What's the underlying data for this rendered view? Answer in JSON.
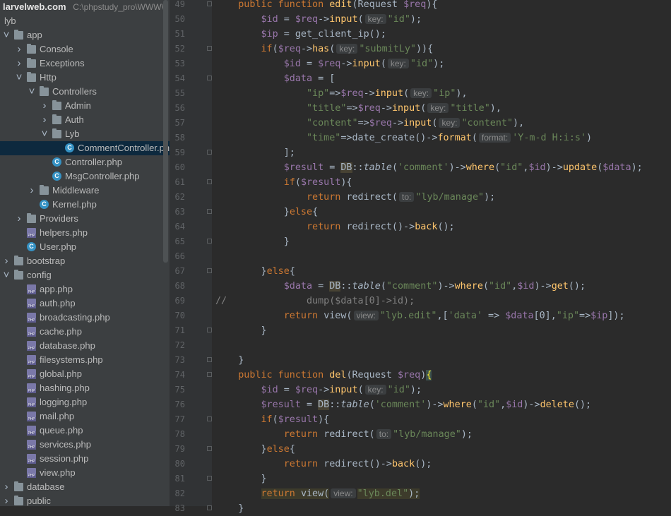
{
  "project": {
    "name": "larvelweb.com",
    "path": "C:\\phpstudy_pro\\WWW\\"
  },
  "tree": [
    {
      "label": "lyb",
      "depth": 0,
      "type": "root",
      "arrow": ""
    },
    {
      "label": "app",
      "depth": 0,
      "type": "folder",
      "arrow": "v"
    },
    {
      "label": "Console",
      "depth": 1,
      "type": "folder",
      "arrow": ">"
    },
    {
      "label": "Exceptions",
      "depth": 1,
      "type": "folder",
      "arrow": ">"
    },
    {
      "label": "Http",
      "depth": 1,
      "type": "folder",
      "arrow": "v"
    },
    {
      "label": "Controllers",
      "depth": 2,
      "type": "folder",
      "arrow": "v"
    },
    {
      "label": "Admin",
      "depth": 3,
      "type": "folder",
      "arrow": ">"
    },
    {
      "label": "Auth",
      "depth": 3,
      "type": "folder",
      "arrow": ">"
    },
    {
      "label": "Lyb",
      "depth": 3,
      "type": "folder",
      "arrow": "v"
    },
    {
      "label": "CommentController.php",
      "depth": 4,
      "type": "class",
      "arrow": "",
      "selected": true
    },
    {
      "label": "Controller.php",
      "depth": 3,
      "type": "class",
      "arrow": ""
    },
    {
      "label": "MsgController.php",
      "depth": 3,
      "type": "class",
      "arrow": ""
    },
    {
      "label": "Middleware",
      "depth": 2,
      "type": "folder",
      "arrow": ">"
    },
    {
      "label": "Kernel.php",
      "depth": 2,
      "type": "class",
      "arrow": ""
    },
    {
      "label": "Providers",
      "depth": 1,
      "type": "folder",
      "arrow": ">"
    },
    {
      "label": "helpers.php",
      "depth": 1,
      "type": "php",
      "arrow": ""
    },
    {
      "label": "User.php",
      "depth": 1,
      "type": "class",
      "arrow": ""
    },
    {
      "label": "bootstrap",
      "depth": 0,
      "type": "folder",
      "arrow": ">"
    },
    {
      "label": "config",
      "depth": 0,
      "type": "folder",
      "arrow": "v"
    },
    {
      "label": "app.php",
      "depth": 1,
      "type": "php",
      "arrow": ""
    },
    {
      "label": "auth.php",
      "depth": 1,
      "type": "php",
      "arrow": ""
    },
    {
      "label": "broadcasting.php",
      "depth": 1,
      "type": "php",
      "arrow": ""
    },
    {
      "label": "cache.php",
      "depth": 1,
      "type": "php",
      "arrow": ""
    },
    {
      "label": "database.php",
      "depth": 1,
      "type": "php",
      "arrow": ""
    },
    {
      "label": "filesystems.php",
      "depth": 1,
      "type": "php",
      "arrow": ""
    },
    {
      "label": "global.php",
      "depth": 1,
      "type": "php",
      "arrow": ""
    },
    {
      "label": "hashing.php",
      "depth": 1,
      "type": "php",
      "arrow": ""
    },
    {
      "label": "logging.php",
      "depth": 1,
      "type": "php",
      "arrow": ""
    },
    {
      "label": "mail.php",
      "depth": 1,
      "type": "php",
      "arrow": ""
    },
    {
      "label": "queue.php",
      "depth": 1,
      "type": "php",
      "arrow": ""
    },
    {
      "label": "services.php",
      "depth": 1,
      "type": "php",
      "arrow": ""
    },
    {
      "label": "session.php",
      "depth": 1,
      "type": "php",
      "arrow": ""
    },
    {
      "label": "view.php",
      "depth": 1,
      "type": "php",
      "arrow": ""
    },
    {
      "label": "database",
      "depth": 0,
      "type": "folder",
      "arrow": ">"
    },
    {
      "label": "public",
      "depth": 0,
      "type": "folder",
      "arrow": ">"
    }
  ],
  "code": [
    {
      "n": "49",
      "fold": true,
      "t": [
        [
          "",
          "    "
        ],
        [
          "kw",
          "public function "
        ],
        [
          "fn",
          "edit"
        ],
        [
          "",
          "(Request "
        ],
        [
          "vr",
          "$req"
        ],
        [
          "",
          "){"
        ]
      ]
    },
    {
      "n": "50",
      "t": [
        [
          "",
          "        "
        ],
        [
          "vr",
          "$id"
        ],
        [
          "",
          " = "
        ],
        [
          "vr",
          "$req"
        ],
        [
          "",
          "->"
        ],
        [
          "mt",
          "input"
        ],
        [
          "",
          "("
        ],
        [
          "hint",
          "key:"
        ],
        [
          "st",
          "\"id\""
        ],
        [
          "",
          "); "
        ]
      ]
    },
    {
      "n": "51",
      "t": [
        [
          "",
          "        "
        ],
        [
          "vr",
          "$ip"
        ],
        [
          "",
          " = get_client_ip();"
        ]
      ]
    },
    {
      "n": "52",
      "fold": true,
      "t": [
        [
          "",
          "        "
        ],
        [
          "kw",
          "if"
        ],
        [
          "",
          "("
        ],
        [
          "vr",
          "$req"
        ],
        [
          "",
          "->"
        ],
        [
          "mt",
          "has"
        ],
        [
          "",
          "("
        ],
        [
          "hint",
          "key:"
        ],
        [
          "st",
          "\"submitLy\""
        ],
        [
          "",
          "))"
        ],
        [
          "",
          "{"
        ]
      ]
    },
    {
      "n": "53",
      "t": [
        [
          "",
          "            "
        ],
        [
          "vr",
          "$id"
        ],
        [
          "",
          " = "
        ],
        [
          "vr",
          "$req"
        ],
        [
          "",
          "->"
        ],
        [
          "mt",
          "input"
        ],
        [
          "",
          "("
        ],
        [
          "hint",
          "key:"
        ],
        [
          "st",
          "\"id\""
        ],
        [
          "",
          ");"
        ]
      ]
    },
    {
      "n": "54",
      "fold": true,
      "t": [
        [
          "",
          "            "
        ],
        [
          "vr",
          "$data"
        ],
        [
          "",
          " = ["
        ]
      ]
    },
    {
      "n": "55",
      "t": [
        [
          "",
          "                "
        ],
        [
          "st",
          "\"ip\""
        ],
        [
          "",
          "=>"
        ],
        [
          "vr",
          "$req"
        ],
        [
          "",
          "->"
        ],
        [
          "mt",
          "input"
        ],
        [
          "",
          "("
        ],
        [
          "hint",
          "key:"
        ],
        [
          "st",
          "\"ip\""
        ],
        [
          "",
          "),"
        ]
      ]
    },
    {
      "n": "56",
      "t": [
        [
          "",
          "                "
        ],
        [
          "st",
          "\"title\""
        ],
        [
          "",
          "=>"
        ],
        [
          "vr",
          "$req"
        ],
        [
          "",
          "->"
        ],
        [
          "mt",
          "input"
        ],
        [
          "",
          "("
        ],
        [
          "hint",
          "key:"
        ],
        [
          "st",
          "\"title\""
        ],
        [
          "",
          "),"
        ]
      ]
    },
    {
      "n": "57",
      "t": [
        [
          "",
          "                "
        ],
        [
          "st",
          "\"content\""
        ],
        [
          "",
          "=>"
        ],
        [
          "vr",
          "$req"
        ],
        [
          "",
          "->"
        ],
        [
          "mt",
          "input"
        ],
        [
          "",
          "("
        ],
        [
          "hint",
          "key:"
        ],
        [
          "st",
          "\"content\""
        ],
        [
          "",
          "),"
        ]
      ]
    },
    {
      "n": "58",
      "t": [
        [
          "",
          "                "
        ],
        [
          "st",
          "\"time\""
        ],
        [
          "",
          "=>date_create()->"
        ],
        [
          "mt",
          "format"
        ],
        [
          "",
          "("
        ],
        [
          "hint",
          "format:"
        ],
        [
          "st",
          "'Y-m-d H:i:s'"
        ],
        [
          "",
          ")"
        ]
      ]
    },
    {
      "n": "59",
      "fold": true,
      "t": [
        [
          "",
          "            ];"
        ]
      ]
    },
    {
      "n": "60",
      "t": [
        [
          "",
          "            "
        ],
        [
          "vr",
          "$result"
        ],
        [
          "",
          " = "
        ],
        [
          "db",
          "DB"
        ],
        [
          "",
          "::"
        ],
        [
          "it",
          "table"
        ],
        [
          "",
          "("
        ],
        [
          "st",
          "'comment'"
        ],
        [
          "",
          ")->"
        ],
        [
          "mt",
          "where"
        ],
        [
          "",
          "("
        ],
        [
          "st",
          "\"id\""
        ],
        [
          "",
          ","
        ],
        [
          "vr",
          "$id"
        ],
        [
          "",
          ")->"
        ],
        [
          "mt",
          "update"
        ],
        [
          "",
          "("
        ],
        [
          "vr",
          "$data"
        ],
        [
          "",
          ");"
        ]
      ]
    },
    {
      "n": "61",
      "fold": true,
      "t": [
        [
          "",
          "            "
        ],
        [
          "kw",
          "if"
        ],
        [
          "",
          "("
        ],
        [
          "vr",
          "$result"
        ],
        [
          "",
          "){"
        ]
      ]
    },
    {
      "n": "62",
      "t": [
        [
          "",
          "                "
        ],
        [
          "kw",
          "return "
        ],
        [
          "",
          "redirect("
        ],
        [
          "hint",
          "to:"
        ],
        [
          "st",
          "\"lyb/manage\""
        ],
        [
          "",
          ");"
        ]
      ]
    },
    {
      "n": "63",
      "fold": true,
      "t": [
        [
          "",
          "            }"
        ],
        [
          "kw",
          "else"
        ],
        [
          "",
          "{"
        ]
      ]
    },
    {
      "n": "64",
      "t": [
        [
          "",
          "                "
        ],
        [
          "kw",
          "return "
        ],
        [
          "",
          "redirect()->"
        ],
        [
          "mt",
          "back"
        ],
        [
          "",
          "();"
        ]
      ]
    },
    {
      "n": "65",
      "fold": true,
      "t": [
        [
          "",
          "            }"
        ]
      ]
    },
    {
      "n": "66",
      "t": [
        [
          "",
          ""
        ]
      ]
    },
    {
      "n": "67",
      "fold": true,
      "t": [
        [
          "",
          "        }"
        ],
        [
          "kw",
          "else"
        ],
        [
          "",
          "{"
        ]
      ]
    },
    {
      "n": "68",
      "t": [
        [
          "",
          "            "
        ],
        [
          "vr",
          "$data"
        ],
        [
          "",
          " = "
        ],
        [
          "db",
          "DB"
        ],
        [
          "",
          "::"
        ],
        [
          "it",
          "table"
        ],
        [
          "",
          "("
        ],
        [
          "st",
          "\"comment\""
        ],
        [
          "",
          ")->"
        ],
        [
          "mt",
          "where"
        ],
        [
          "",
          "("
        ],
        [
          "st",
          "\"id\""
        ],
        [
          "",
          ","
        ],
        [
          "vr",
          "$id"
        ],
        [
          "",
          ")->"
        ],
        [
          "mt",
          "get"
        ],
        [
          "",
          "();"
        ]
      ]
    },
    {
      "n": "69",
      "t": [
        [
          "cm",
          "//"
        ],
        [
          "",
          "              "
        ],
        [
          "cm",
          "dump($data[0]->id);"
        ]
      ]
    },
    {
      "n": "70",
      "t": [
        [
          "",
          "            "
        ],
        [
          "kw",
          "return "
        ],
        [
          "",
          "view("
        ],
        [
          "hint",
          "view:"
        ],
        [
          "st",
          "\"lyb.edit\""
        ],
        [
          "",
          ",["
        ],
        [
          "st",
          "'data'"
        ],
        [
          "",
          " => "
        ],
        [
          "vr",
          "$data"
        ],
        [
          "",
          "[0],"
        ],
        [
          "st",
          "\"ip\""
        ],
        [
          "",
          "=>"
        ],
        [
          "vr",
          "$ip"
        ],
        [
          "",
          "]);"
        ]
      ]
    },
    {
      "n": "71",
      "fold": true,
      "t": [
        [
          "",
          "        }"
        ]
      ]
    },
    {
      "n": "72",
      "t": [
        [
          "",
          ""
        ]
      ]
    },
    {
      "n": "73",
      "fold": true,
      "t": [
        [
          "",
          "    }"
        ]
      ]
    },
    {
      "n": "74",
      "fold": true,
      "t": [
        [
          "",
          "    "
        ],
        [
          "kw",
          "public function "
        ],
        [
          "fn",
          "del"
        ],
        [
          "",
          "(Request "
        ],
        [
          "vr",
          "$req"
        ],
        [
          "",
          ")"
        ],
        [
          "brace",
          "{"
        ]
      ]
    },
    {
      "n": "75",
      "t": [
        [
          "",
          "        "
        ],
        [
          "vr",
          "$id"
        ],
        [
          "",
          " = "
        ],
        [
          "vr",
          "$req"
        ],
        [
          "",
          "->"
        ],
        [
          "mt",
          "input"
        ],
        [
          "",
          "("
        ],
        [
          "hint",
          "key:"
        ],
        [
          "st",
          "\"id\""
        ],
        [
          "",
          ");"
        ]
      ]
    },
    {
      "n": "76",
      "t": [
        [
          "",
          "        "
        ],
        [
          "vr",
          "$result"
        ],
        [
          "",
          " = "
        ],
        [
          "db",
          "DB"
        ],
        [
          "",
          "::"
        ],
        [
          "it",
          "table"
        ],
        [
          "",
          "("
        ],
        [
          "st",
          "'comment'"
        ],
        [
          "",
          ")->"
        ],
        [
          "mt",
          "where"
        ],
        [
          "",
          "("
        ],
        [
          "st",
          "\"id\""
        ],
        [
          "",
          ","
        ],
        [
          "vr",
          "$id"
        ],
        [
          "",
          ")->"
        ],
        [
          "mt",
          "delete"
        ],
        [
          "",
          "();"
        ]
      ]
    },
    {
      "n": "77",
      "fold": true,
      "t": [
        [
          "",
          "        "
        ],
        [
          "kw",
          "if"
        ],
        [
          "",
          "("
        ],
        [
          "vr",
          "$result"
        ],
        [
          "",
          "){"
        ]
      ]
    },
    {
      "n": "78",
      "t": [
        [
          "",
          "            "
        ],
        [
          "kw",
          "return "
        ],
        [
          "",
          "redirect("
        ],
        [
          "hint",
          "to:"
        ],
        [
          "st",
          "\"lyb/manage\""
        ],
        [
          "",
          ");"
        ]
      ]
    },
    {
      "n": "79",
      "fold": true,
      "t": [
        [
          "",
          "        }"
        ],
        [
          "kw",
          "else"
        ],
        [
          "",
          "{"
        ]
      ]
    },
    {
      "n": "80",
      "t": [
        [
          "",
          "            "
        ],
        [
          "kw",
          "return "
        ],
        [
          "",
          "redirect()->"
        ],
        [
          "mt",
          "back"
        ],
        [
          "",
          "();"
        ]
      ]
    },
    {
      "n": "81",
      "fold": true,
      "t": [
        [
          "",
          "        }"
        ]
      ]
    },
    {
      "n": "82",
      "t": [
        [
          "",
          "        "
        ],
        [
          "ret",
          "return "
        ],
        [
          "ret2",
          "view("
        ],
        [
          "hint",
          "view:"
        ],
        [
          "retst",
          "\"lyb.del\""
        ],
        [
          "ret2",
          ");"
        ]
      ]
    },
    {
      "n": "83",
      "fold": true,
      "t": [
        [
          "",
          "    }"
        ]
      ]
    }
  ]
}
